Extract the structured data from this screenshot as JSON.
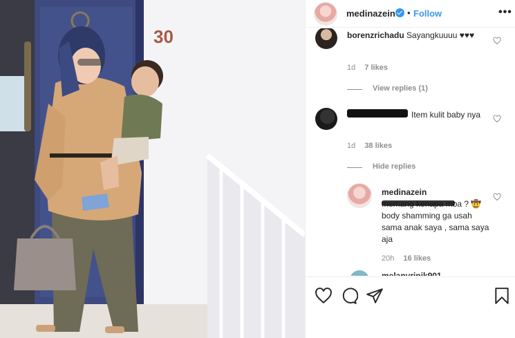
{
  "post": {
    "author": "medinazein",
    "separator": "•",
    "follow_label": "Follow",
    "more_label": "•••",
    "photo_door_number": "30"
  },
  "comments": [
    {
      "username": "borenzrichadu",
      "text": "Sayangkuuuu ♥♥♥",
      "time": "1d",
      "likes": "7 likes",
      "thread": "View replies (1)"
    },
    {
      "username": "",
      "text": "Item kulit baby nya",
      "time": "1d",
      "likes": "38 likes",
      "thread": "Hide replies"
    }
  ],
  "reply": {
    "username": "medinazein",
    "text": "memang kenapa mba ? 🤠 body shamming ga usah sama anak saya , sama saya aja",
    "time": "20h",
    "likes": "16 likes"
  },
  "next_comment_partial": "melanyrinik901",
  "colors": {
    "link": "#3897f0",
    "muted": "#8e8e8e",
    "text": "#262626",
    "border": "#efefef"
  },
  "icons": [
    "heart-icon",
    "comment-icon",
    "share-icon",
    "bookmark-icon",
    "verified-badge-icon",
    "more-options-icon"
  ]
}
